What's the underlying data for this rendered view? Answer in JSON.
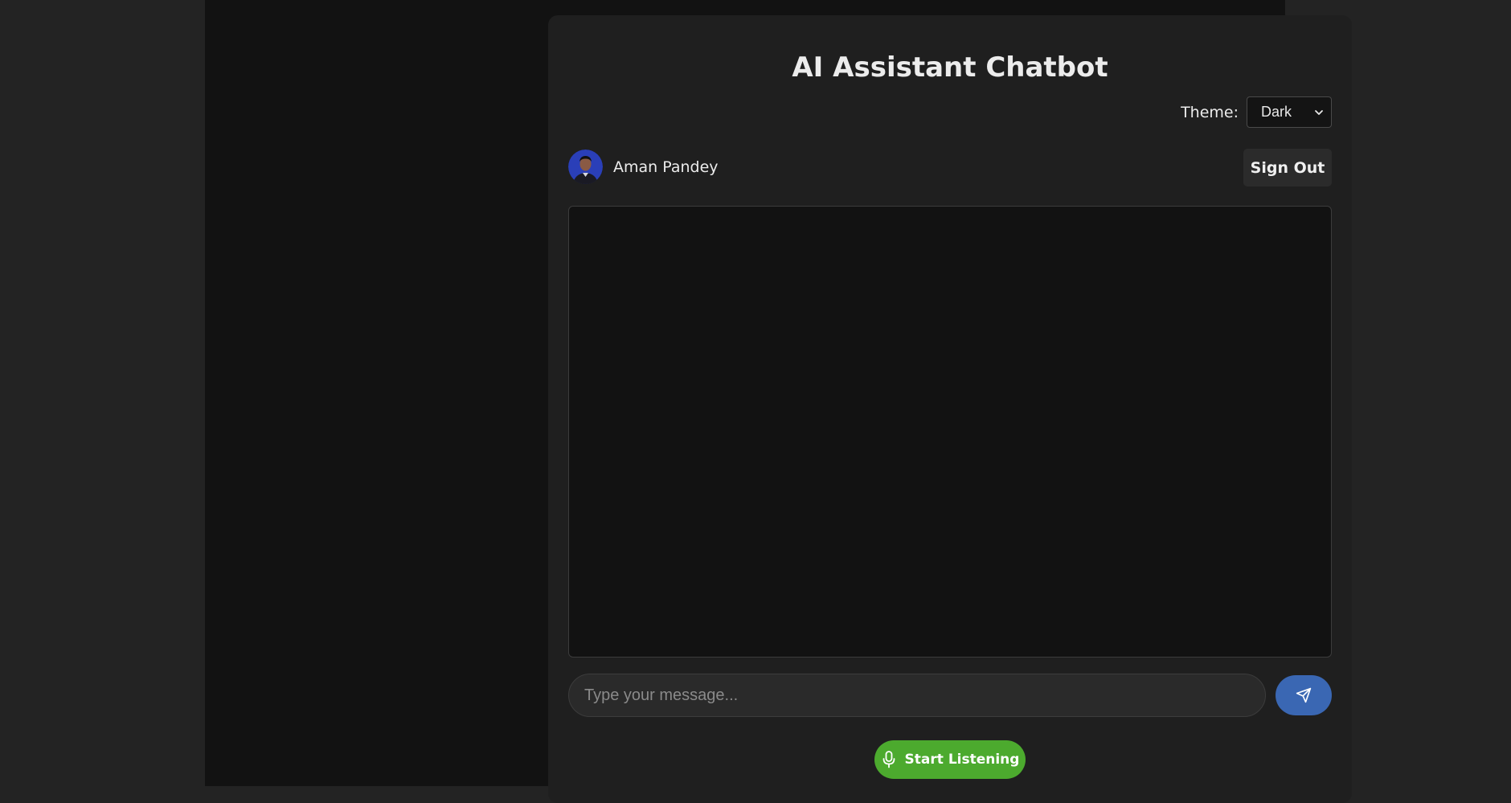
{
  "app": {
    "title": "AI Assistant Chatbot"
  },
  "theme": {
    "label": "Theme:",
    "selected": "Dark"
  },
  "user": {
    "name": "Aman Pandey",
    "avatar_icon": "user-avatar"
  },
  "actions": {
    "sign_out": "Sign Out",
    "start_listening": "Start Listening"
  },
  "composer": {
    "placeholder": "Type your message...",
    "send_icon": "send-icon"
  },
  "colors": {
    "send_button": "#3a67b3",
    "listen_button": "#4caa2e"
  }
}
